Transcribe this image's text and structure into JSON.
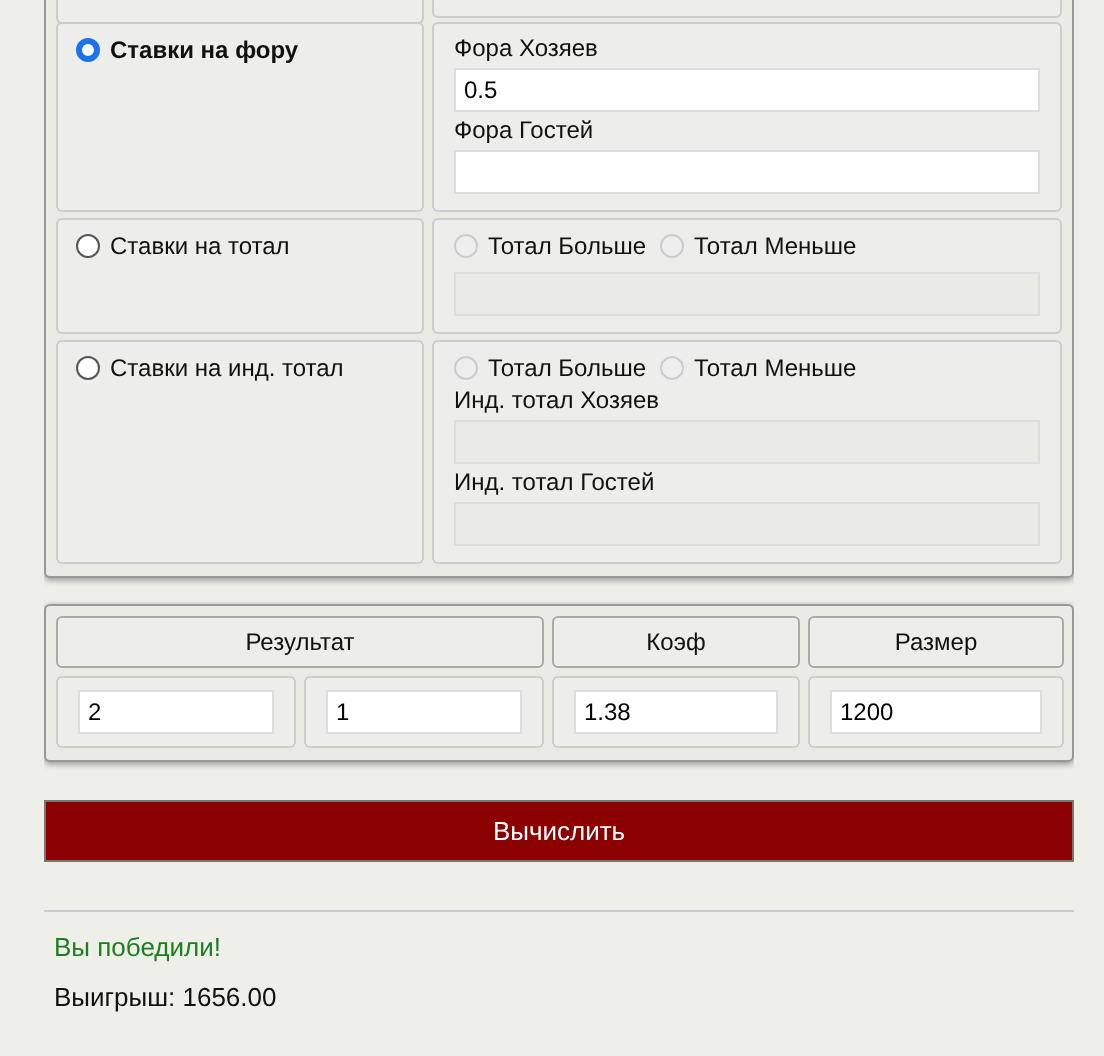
{
  "bet_types": [
    {
      "label": "Ставки на фору",
      "selected": true,
      "fields": [
        {
          "label": "Фора Хозяев",
          "value": "0.5",
          "disabled": false
        },
        {
          "label": "Фора Гостей",
          "disabled": false
        }
      ]
    },
    {
      "label": "Ставки на тотал",
      "selected": false,
      "choices": [
        {
          "label": "Тотал Больше",
          "selected": false,
          "disabled": true
        },
        {
          "label": "Тотал Меньше",
          "selected": false,
          "disabled": true
        }
      ],
      "fields": [
        {
          "disabled": true
        }
      ]
    },
    {
      "label": "Ставки на инд. тотал",
      "selected": false,
      "choices": [
        {
          "label": "Тотал Больше",
          "selected": false,
          "disabled": true
        },
        {
          "label": "Тотал Меньше",
          "selected": false,
          "disabled": true
        }
      ],
      "fields": [
        {
          "label": "Инд. тотал Хозяев",
          "disabled": true
        },
        {
          "label": "Инд. тотал Гостей",
          "disabled": true
        }
      ]
    }
  ],
  "bet_table": {
    "columns": [
      "Результат",
      "Коэф",
      "Размер"
    ],
    "values": [
      "2",
      "1",
      "1.38",
      "1200"
    ]
  },
  "calculate_button": "Вычислить",
  "result": {
    "kind": "win",
    "message": "Вы победили!",
    "payout": "Выигрыш: 1656.00"
  }
}
